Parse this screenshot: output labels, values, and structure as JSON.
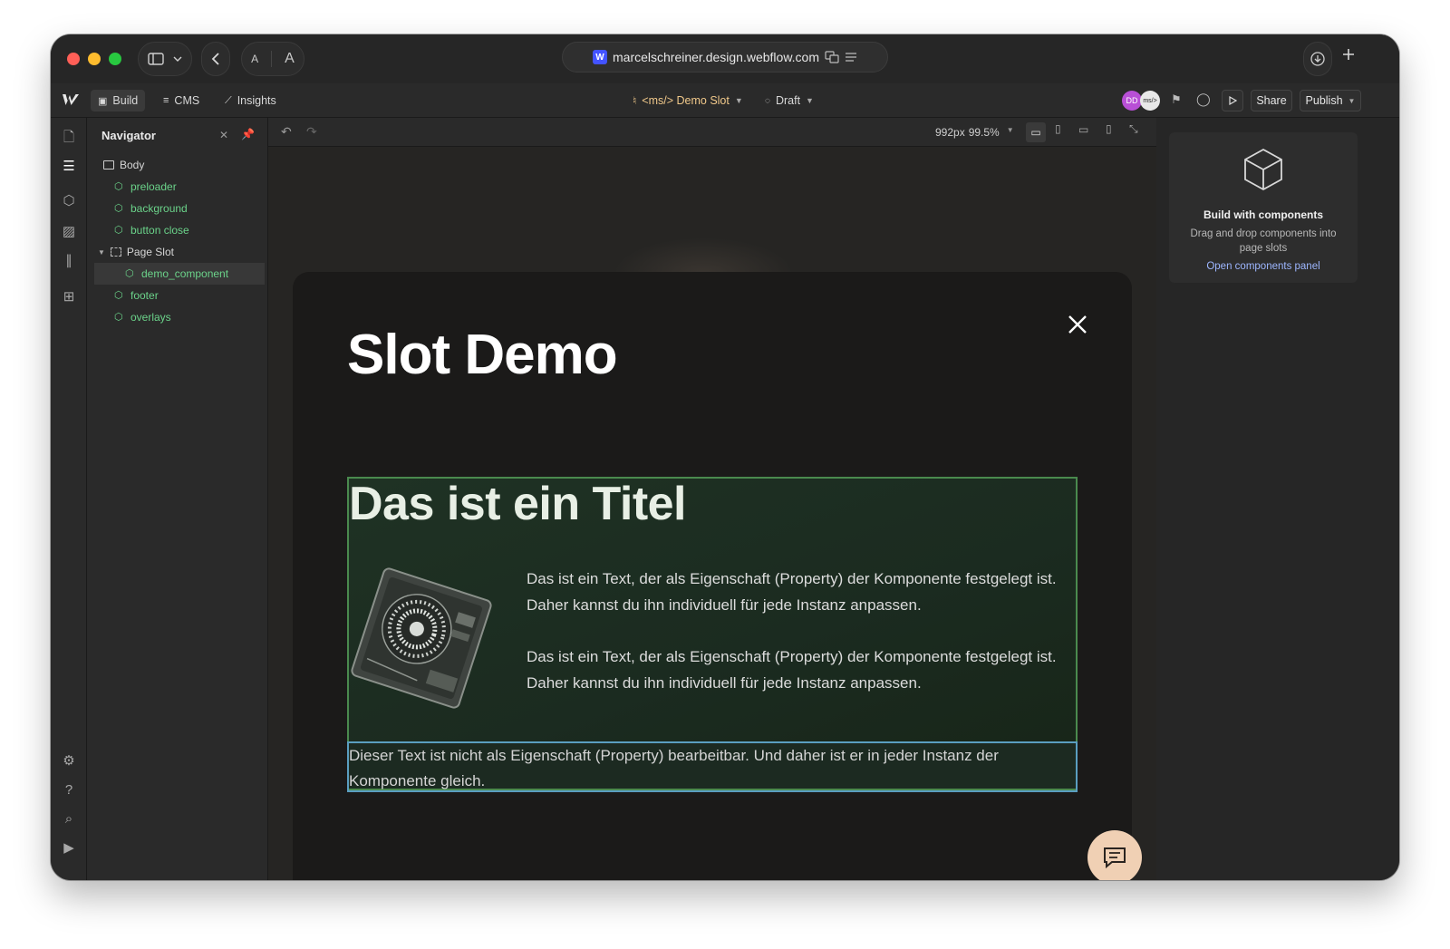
{
  "browser": {
    "url": "marcelschreiner.design.webflow.com",
    "font_small": "A",
    "font_large": "A",
    "icons": [
      "sidebar-toggle-icon",
      "chevron-down-icon",
      "back-icon",
      "translate-icon",
      "reader-icon",
      "download-icon",
      "new-tab-icon"
    ]
  },
  "toolbar": {
    "build": "Build",
    "cms": "CMS",
    "insights": "Insights",
    "page": "<ms/> Demo Slot",
    "status": "Draft",
    "avatar1": "DD",
    "avatar2": "ms/>",
    "share": "Share",
    "publish": "Publish"
  },
  "navigator": {
    "title": "Navigator",
    "items": [
      {
        "label": "Body"
      },
      {
        "label": "preloader"
      },
      {
        "label": "background"
      },
      {
        "label": "button close"
      },
      {
        "label": "Page Slot"
      },
      {
        "label": "demo_component"
      },
      {
        "label": "footer"
      },
      {
        "label": "overlays"
      }
    ]
  },
  "canvas": {
    "size": "992px",
    "zoom": "99.5%"
  },
  "page": {
    "title": "Slot Demo",
    "component_title": "Das ist ein Titel",
    "para1": "Das ist ein Text, der als Eigenschaft (Property) der Komponente festgelegt ist. Daher kannst du ihn individuell für jede Instanz anpassen.",
    "para2": "Das ist ein Text, der als Eigenschaft (Property) der Komponente festgelegt ist. Daher kannst du ihn individuell für jede Instanz anpassen.",
    "static_text": "Dieser Text ist nicht als Eigenschaft (Property) bearbeitbar. Und daher ist er in jeder Instanz der Komponente gleich."
  },
  "components_panel": {
    "title": "Build with components",
    "description": "Drag and drop components into page slots",
    "link": "Open components panel"
  },
  "colors": {
    "accent_component": "#6bd38a",
    "slot_border": "#4a8a4e",
    "selection_border": "#5a9ec0",
    "chat_button": "#f0d0b4"
  }
}
